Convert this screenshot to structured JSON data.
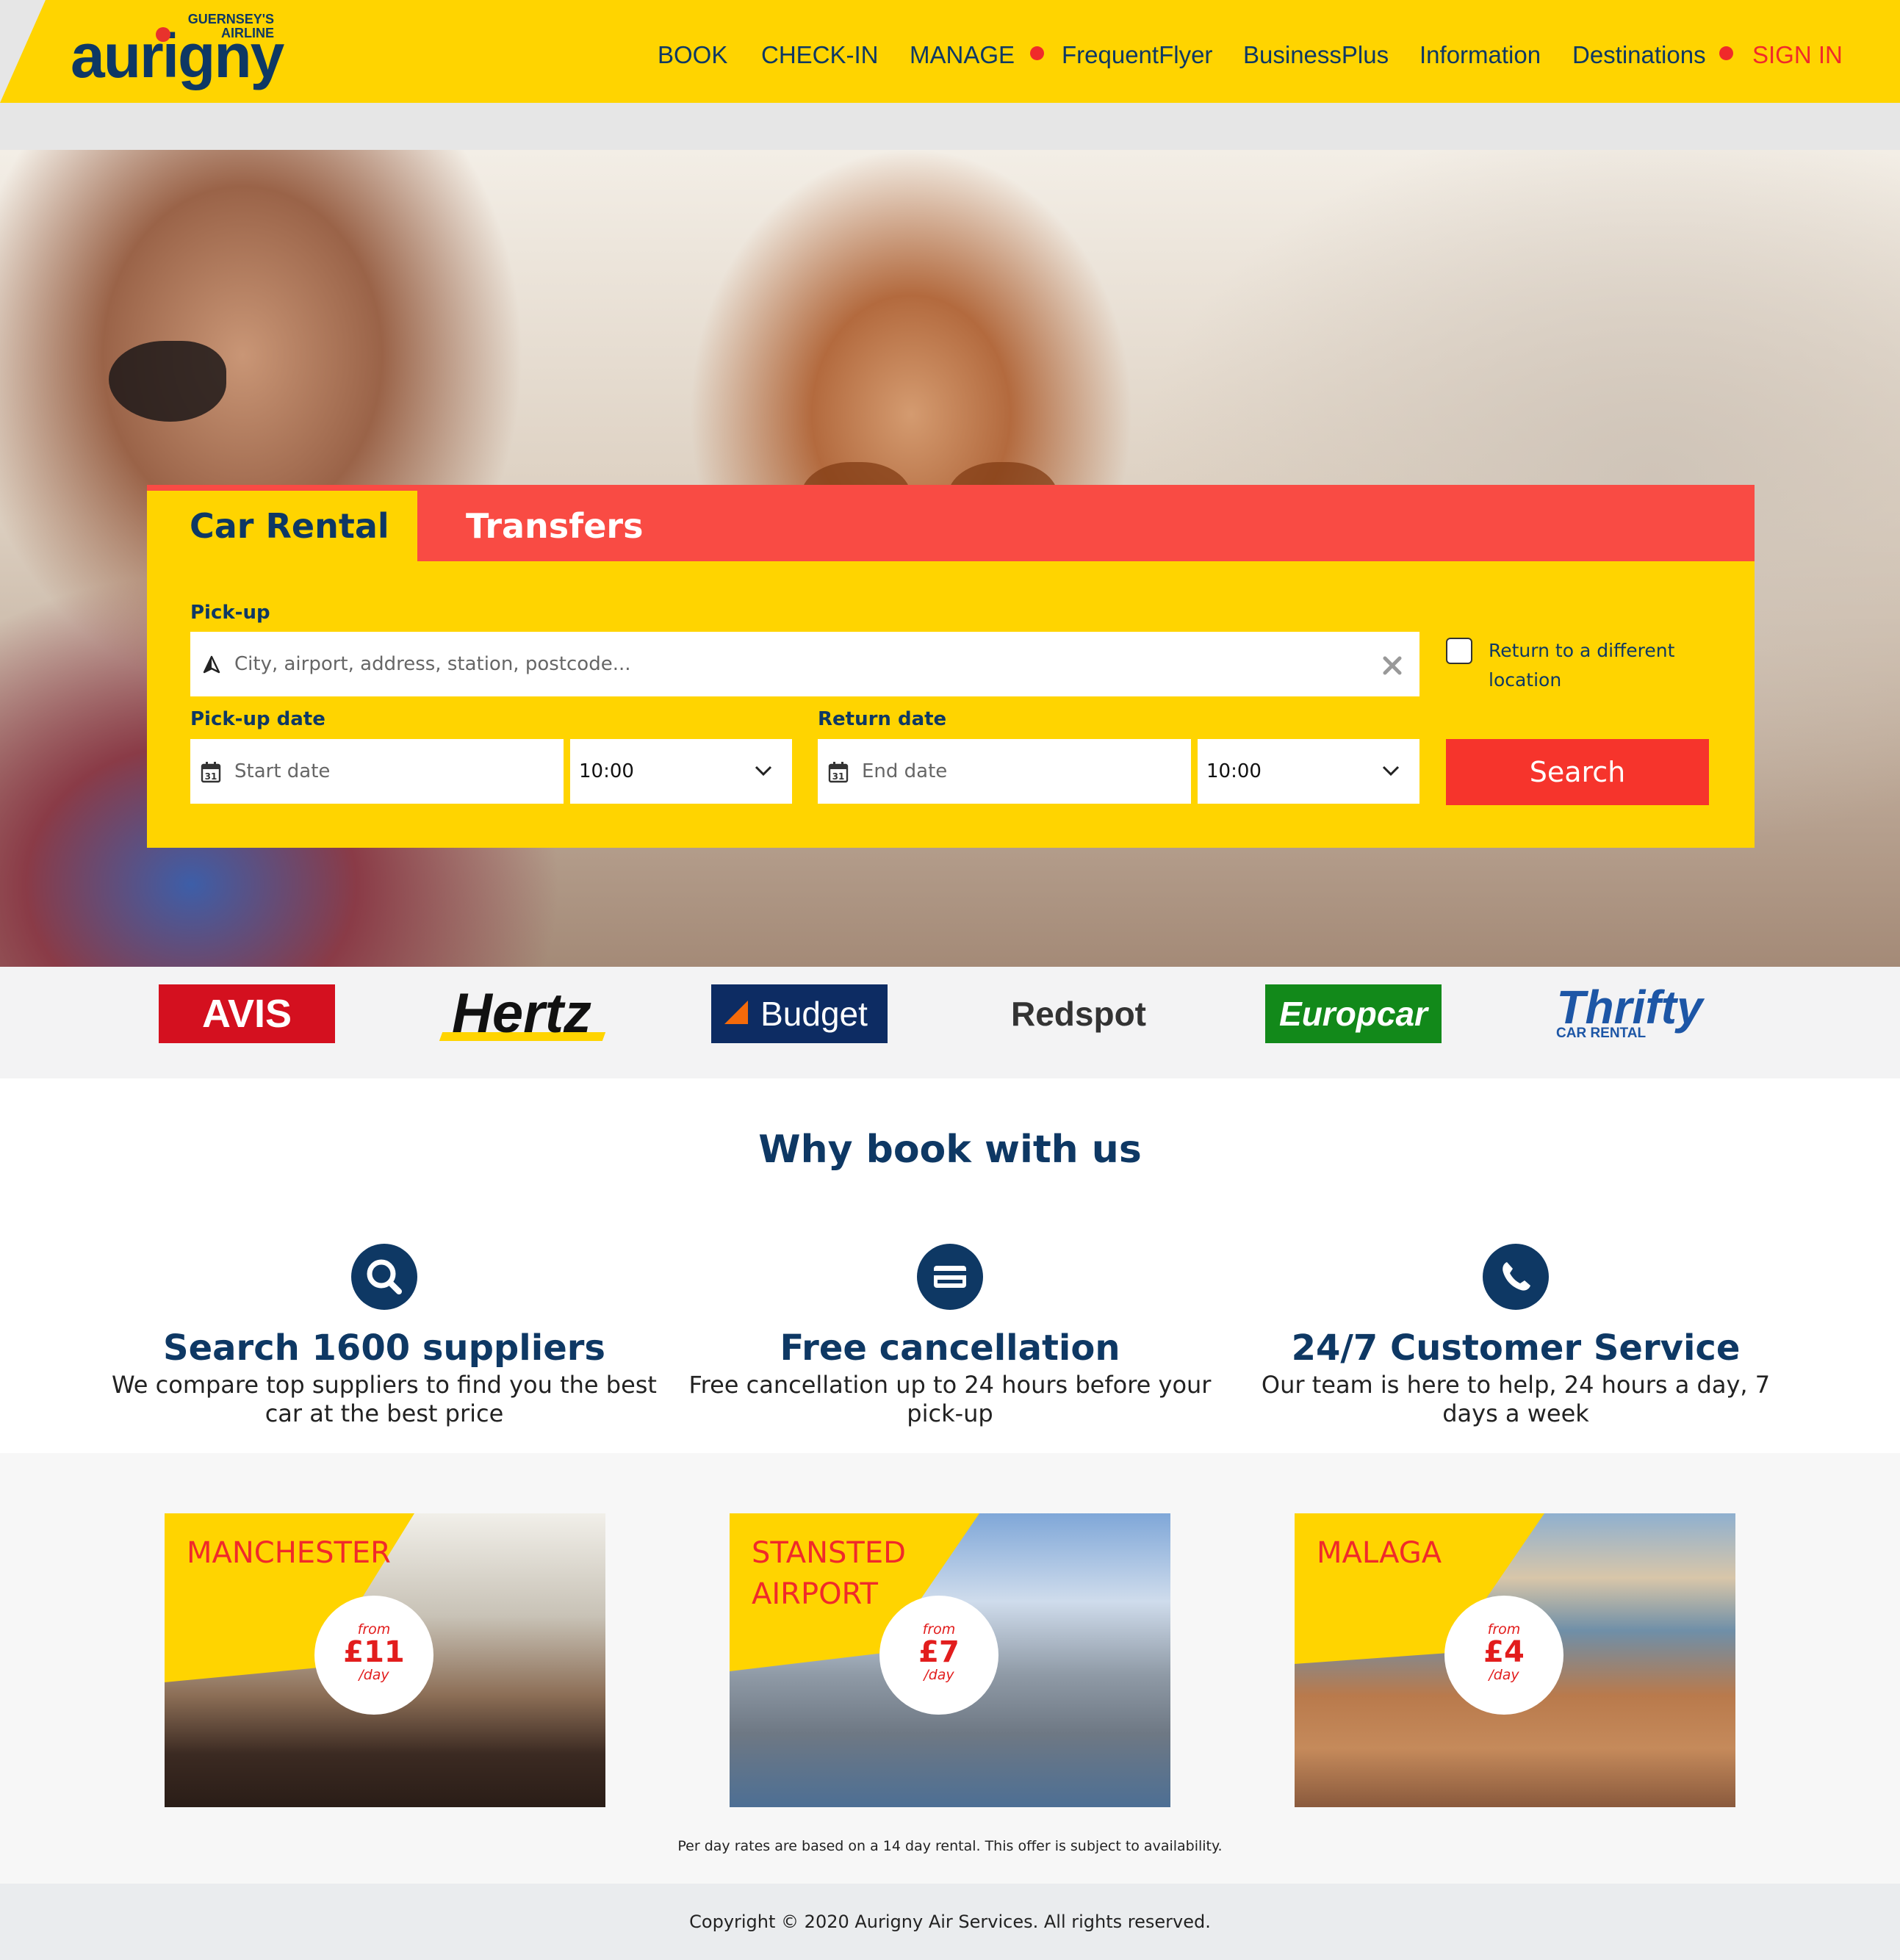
{
  "brand": {
    "tagline": "GUERNSEY'S AIRLINE",
    "name": "aurigny",
    "colors": {
      "yellow": "#ffd400",
      "navy": "#0e3864",
      "red": "#f02a2a"
    }
  },
  "nav": {
    "book": "BOOK",
    "checkin": "CHECK-IN",
    "manage": "MANAGE",
    "frequent_flyer": "FrequentFlyer",
    "business_plus": "BusinessPlus",
    "information": "Information",
    "destinations": "Destinations",
    "sign_in": "SIGN IN"
  },
  "booking": {
    "tabs": {
      "car_rental": "Car Rental",
      "transfers": "Transfers"
    },
    "active_tab": "Car Rental",
    "pickup": {
      "label": "Pick-up",
      "placeholder": "City, airport, address, station, postcode...",
      "icon": "location-arrow-icon"
    },
    "return_different": "Return to a different location",
    "pickup_date": {
      "label": "Pick-up date",
      "placeholder": "Start date",
      "time": "10:00",
      "calendar_day": "31"
    },
    "return_date": {
      "label": "Return date",
      "placeholder": "End date",
      "time": "10:00",
      "calendar_day": "31"
    },
    "search_button": "Search"
  },
  "suppliers": {
    "avis": "AVIS",
    "hertz": "Hertz",
    "budget": "Budget",
    "redspot": "Redspot",
    "europcar": "Europcar",
    "thrifty": "Thrifty",
    "thrifty_sub": "CAR RENTAL"
  },
  "why": {
    "title": "Why book with us",
    "features": [
      {
        "icon": "search-icon",
        "title": "Search 1600 suppliers",
        "text": "We compare top suppliers to find you the best car at the best price"
      },
      {
        "icon": "credit-card-icon",
        "title": "Free cancellation",
        "text": "Free cancellation up to 24 hours before your pick-up"
      },
      {
        "icon": "phone-icon",
        "title": "24/7 Customer Service",
        "text": "Our team is here to help, 24 hours a day, 7 days a week"
      }
    ]
  },
  "destinations": [
    {
      "name": "MANCHESTER",
      "from": "from",
      "price": "£11",
      "per": "/day"
    },
    {
      "name": "STANSTED AIRPORT",
      "from": "from",
      "price": "£7",
      "per": "/day"
    },
    {
      "name": "MALAGA",
      "from": "from",
      "price": "£4",
      "per": "/day"
    }
  ],
  "disclaimer": "Per day rates are based on a 14 day rental. This offer is subject to availability.",
  "footer": {
    "copyright": "Copyright © 2020 Aurigny Air Services. All rights reserved."
  }
}
